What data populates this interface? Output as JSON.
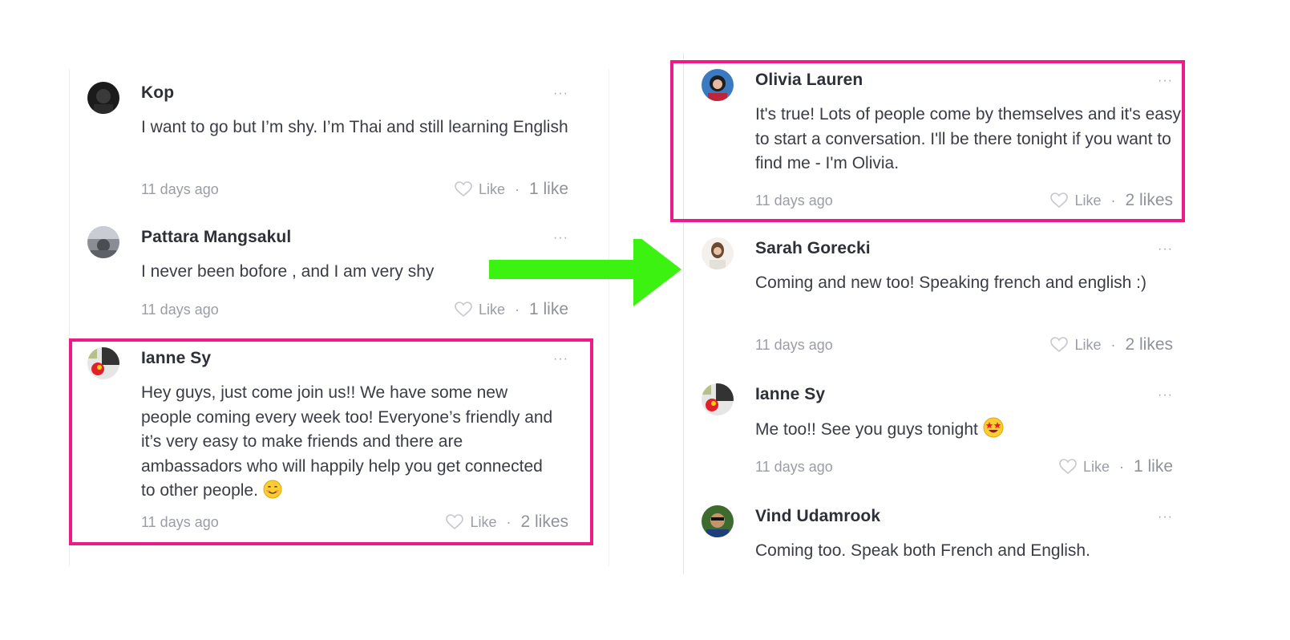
{
  "colors": {
    "highlight": "#ef1a88",
    "arrow": "#3cf210"
  },
  "left_comments": [
    {
      "author": "Kop",
      "text": "I want to go but I’m shy. I’m Thai and still learning English",
      "time": "11 days ago",
      "like_label": "Like",
      "like_count": "1 like",
      "more": "···"
    },
    {
      "author": "Pattara Mangsakul",
      "text": "I never been bofore , and I am very shy",
      "time": "11 days ago",
      "like_label": "Like",
      "like_count": "1 like",
      "more": "···"
    },
    {
      "author": "Ianne Sy",
      "text": "Hey guys, just come join us!! We have some new people coming every week too! Everyone’s friendly and it’s very easy to make friends and there are ambassadors who will happily help you get connected to other people.",
      "emoji": "smiling-face-emoji",
      "time": "11 days ago",
      "like_label": "Like",
      "like_count": "2 likes",
      "more": "···"
    }
  ],
  "right_comments": [
    {
      "author": "Olivia Lauren",
      "text": "It's true! Lots of people come by themselves and it's easy to start a conversation. I'll be there tonight if you want to find me - I'm Olivia.",
      "time": "11 days ago",
      "like_label": "Like",
      "like_count": "2 likes",
      "more": "···"
    },
    {
      "author": "Sarah Gorecki",
      "text": "Coming and new too! Speaking french and english :)",
      "time": "11 days ago",
      "like_label": "Like",
      "like_count": "2 likes",
      "more": "···"
    },
    {
      "author": "Ianne Sy",
      "text": "Me too!! See you guys tonight",
      "emoji": "star-struck-emoji",
      "time": "11 days ago",
      "like_label": "Like",
      "like_count": "1 like",
      "more": "···"
    },
    {
      "author": "Vind Udamrook",
      "text": "Coming too. Speak both French and English.",
      "more": "···"
    }
  ]
}
